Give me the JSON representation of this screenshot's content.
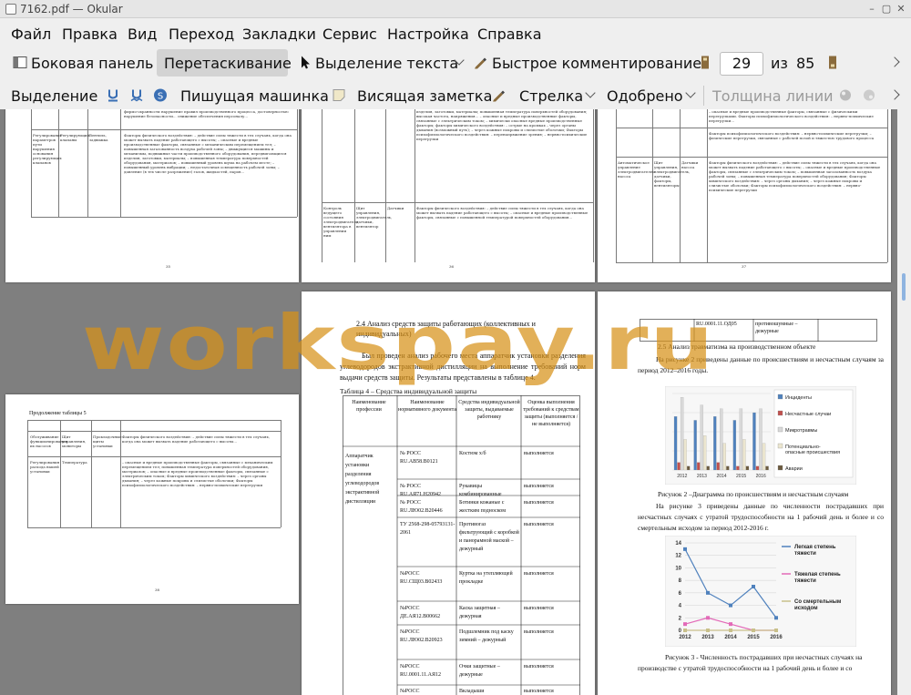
{
  "window": {
    "title": "7162.pdf  — Okular"
  },
  "menu": [
    "Файл",
    "Правка",
    "Вид",
    "Переход",
    "Закладки",
    "Сервис",
    "Настройка",
    "Справка"
  ],
  "toolbar1": {
    "sidebar": "Боковая панель",
    "browse": "Перетаскивание",
    "text_select": "Выделение текста",
    "quick_comment": "Быстрое комментирование",
    "page_current": "29",
    "page_of": "из",
    "page_total": "85"
  },
  "toolbar2": {
    "highlight": "Выделение",
    "typewriter": "Пишущая машинка",
    "sticky_note": "Висящая заметка",
    "arrow": "Стрелка",
    "approved": "Одобрено",
    "line_width": "Толщина линии"
  },
  "watermark": "workspay.ru",
  "doc": {
    "small_page_header": "Продолжение таблицы 5",
    "mid_heading": "2.4  Анализ  средств  защиты  работающих  (коллективных  и индивидуальных)",
    "mid_para": "Был проведен анализ рабочего места аппаратчик установки разделения углеводородов экстрактивной дистилляции на выполнение требований норм выдачи средств защиты. Результаты представлены в таблице 4.",
    "table_caption": "Таблица 4 – Средства индивидуальной защиты",
    "table": {
      "headers": [
        "Наименование профессии",
        "Наименование нормативного документа",
        "Средства индивидуальной защиты, выдаваемые работнику",
        "Оценка выполнения требований к средствам защиты (выполняется / не выполняется)"
      ],
      "profession": "Аппаратчик установки разделения углеводородов экстрактивной дистилляции",
      "rows": [
        [
          "№ РОСС RU.АВ58.В0121",
          "Костюм х/б",
          "выполняется"
        ],
        [
          "№ РОСС RU.АЯ71.Н20942",
          "Рукавицы комбинированные",
          "выполняется"
        ],
        [
          "№ РОСС RU.ЛЮ02.В20446",
          "Ботинки кожаные с жестким подноском",
          "выполняется"
        ],
        [
          "ТУ 2568-298-05793131-2061",
          "Противогаз фильтрующий с коробкой и панорамной маской – дежурный",
          "выполняется"
        ],
        [
          "№РОСС RU.СЩ03.В02433",
          "Куртка на утепляющей прокладке",
          "выполняется"
        ],
        [
          "№РОСС ДЕ.АЯ12.В00662",
          "Каска защитная – дежурная",
          "выполняется"
        ],
        [
          "№РОСС RU.ЛЮ02.В20923",
          "Подшлемник под каску зимний – дежурный",
          "выполняется"
        ],
        [
          "№РОСС RU.0001.11.АЯ12",
          "Очки защитные – дежурные",
          "выполняется"
        ],
        [
          "№РОСС",
          "Вкладыши",
          "выполняется"
        ]
      ]
    },
    "right_top_cells": [
      "RU.0001.11.ОД05",
      "противошумные – дежурные"
    ],
    "right_heading": "2.5 Анализ травматизма на производственном объекте",
    "right_para1": "На  рисунке  2  приведены  данные  по  происшествиям  и  несчастным случаям за период 2012–2016 годы.",
    "fig2_caption": "Рисунок 2 –Диаграмма по происшествиям и несчастным случаям",
    "right_para2": "На  рисунке  3  приведены  данные  по  численности  пострадавших  при несчастных случаях с утратой трудоспособности на 1 рабочий день и более и со смертельным исходом за период 2012-2016 г.",
    "fig3_caption": "Рисунок 3 - Численность пострадавших при несчастных случаях на производстве с утратой трудоспособности на 1 рабочий день и более и со"
  },
  "chart_data": [
    {
      "type": "bar",
      "categories": [
        "2012",
        "2013",
        "2014",
        "2015",
        "2016"
      ],
      "series": [
        {
          "name": "Инциденты",
          "values": [
            14,
            13,
            14,
            13,
            15
          ],
          "color": "#4f81bd"
        },
        {
          "name": "Несчастные случаи",
          "values": [
            2,
            2,
            2,
            1,
            1
          ],
          "color": "#c0504d"
        },
        {
          "name": "Микротравмы",
          "values": [
            19,
            17,
            16,
            16,
            16
          ],
          "color": "#d9d9d9"
        },
        {
          "name": "Потенциально-опасные происшествия",
          "values": [
            8,
            9,
            7,
            8,
            7
          ],
          "color": "#ece6cf"
        },
        {
          "name": "Аварии",
          "values": [
            1,
            1,
            1,
            1,
            1
          ],
          "color": "#6b5a3e"
        }
      ],
      "ylim": [
        0,
        20
      ],
      "legend": "right"
    },
    {
      "type": "line",
      "x": [
        "2012",
        "2013",
        "2014",
        "2015",
        "2016"
      ],
      "series": [
        {
          "name": "Легкая степень тяжести",
          "values": [
            13,
            6,
            4,
            7,
            2
          ],
          "color": "#4f81bd"
        },
        {
          "name": "Тяжелая степень тяжести",
          "values": [
            1,
            2,
            1,
            0,
            0
          ],
          "color": "#e36ab8"
        },
        {
          "name": "Со смертельным исходом",
          "values": [
            0,
            0,
            0,
            0,
            0
          ],
          "color": "#c9c08a"
        }
      ],
      "yticks": [
        "0",
        "2",
        "4",
        "6",
        "8",
        "10",
        "12",
        "14"
      ],
      "ylim": [
        0,
        14
      ],
      "legend": "right"
    }
  ]
}
